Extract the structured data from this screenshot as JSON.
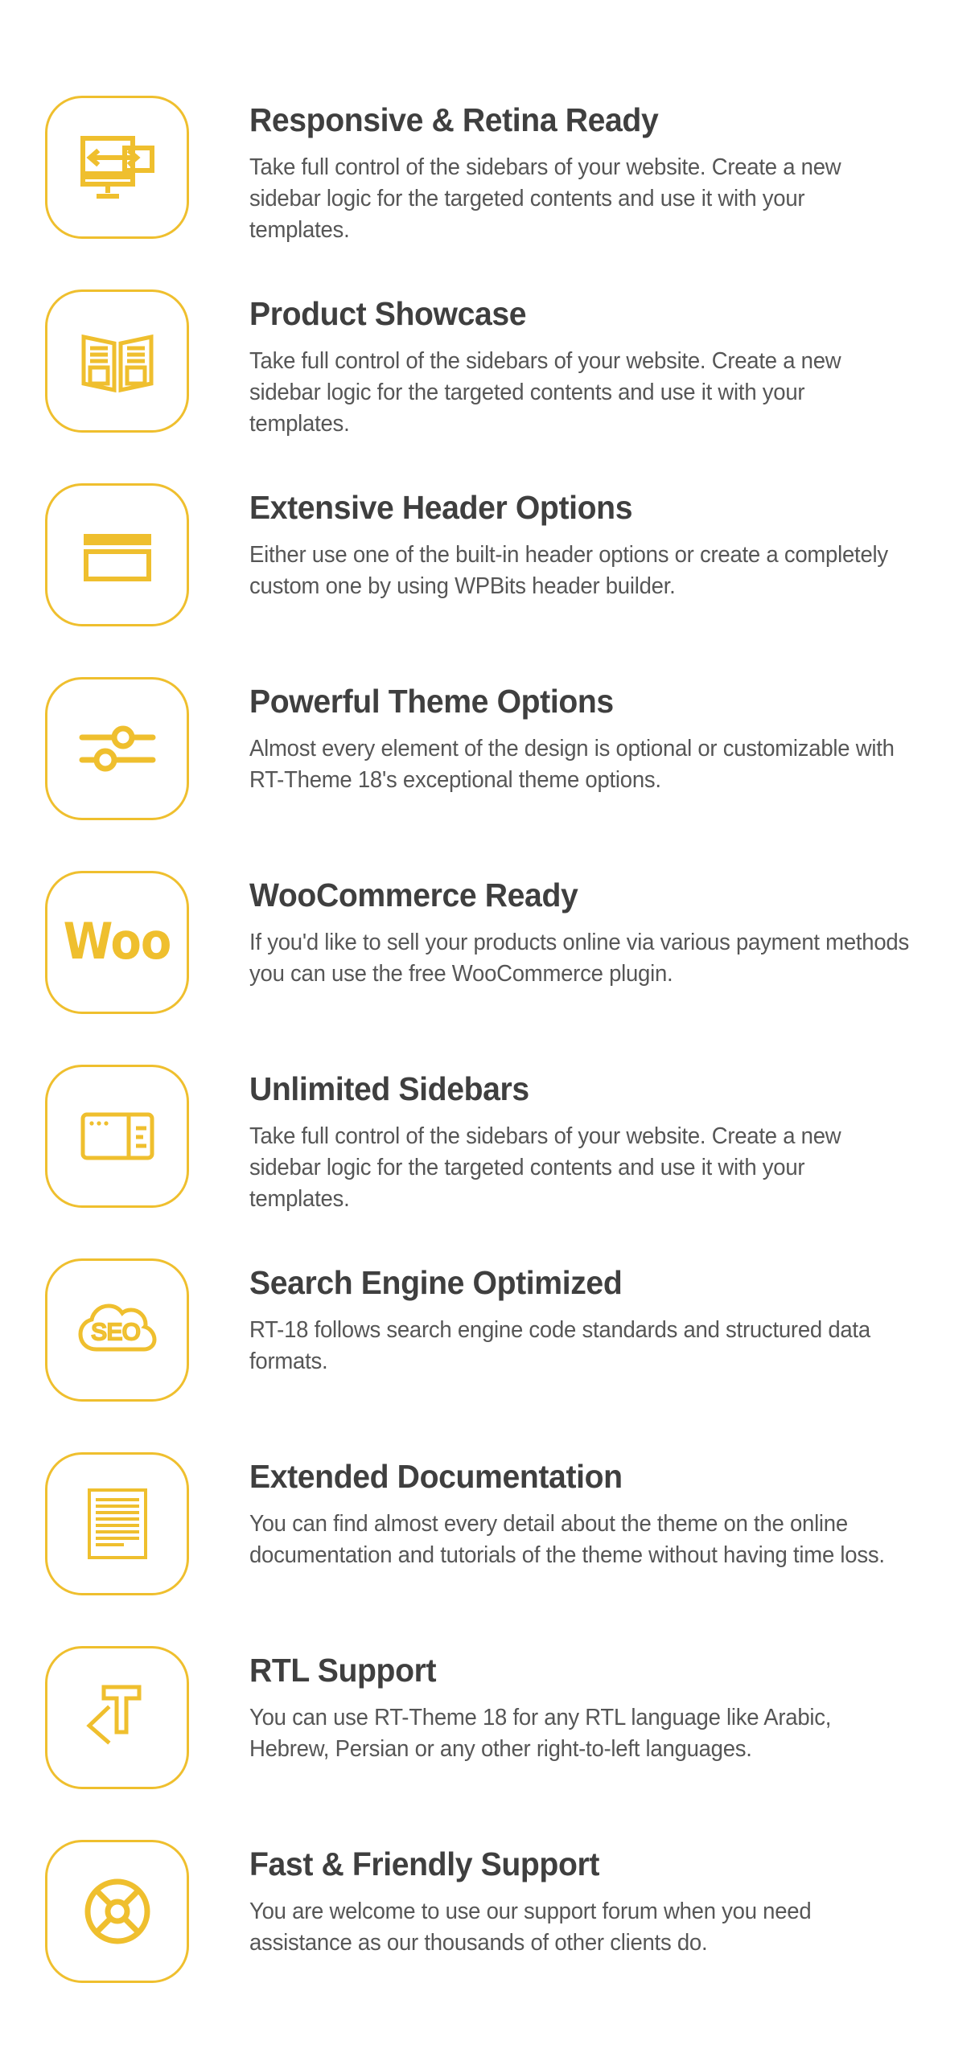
{
  "theme": {
    "accent_color": "#efbf2e",
    "title_color": "#3f3f3f",
    "body_color": "#565656",
    "background_color": "#ffffff"
  },
  "features": [
    {
      "icon": "responsive-monitor-icon",
      "title": "Responsive & Retina Ready",
      "description": "Take full control of the sidebars of your website. Create a new sidebar logic for the targeted contents and use it with your templates."
    },
    {
      "icon": "brochure-icon",
      "title": "Product Showcase",
      "description": "Take full control of the sidebars of your website. Create a new sidebar logic for the targeted contents and use it with your templates."
    },
    {
      "icon": "header-layout-icon",
      "title": "Extensive Header Options",
      "description": "Either use one of the built-in header options or create a completely custom one by using WPBits header builder."
    },
    {
      "icon": "sliders-icon",
      "title": "Powerful Theme Options",
      "description": "Almost every element of the design is optional or customizable with RT-Theme 18's exceptional theme options."
    },
    {
      "icon": "woocommerce-icon",
      "icon_text": "Woo",
      "title": "WooCommerce Ready",
      "description": "If you'd like to sell your products online via various payment methods you can use the free WooCommerce plugin."
    },
    {
      "icon": "sidebar-layout-icon",
      "title": "Unlimited Sidebars",
      "description": "Take full control of the sidebars of your website. Create a new sidebar logic for the targeted contents and use it with your templates."
    },
    {
      "icon": "seo-cloud-icon",
      "icon_text": "SEO",
      "title": "Search Engine Optimized",
      "description": "RT-18 follows search engine code standards and structured data formats."
    },
    {
      "icon": "document-lines-icon",
      "title": "Extended Documentation",
      "description": "You can find almost every detail about the theme on the online documentation and tutorials of the theme without having time loss."
    },
    {
      "icon": "rtl-text-icon",
      "title": "RTL Support",
      "description": "You can use RT-Theme 18 for any RTL language like Arabic, Hebrew, Persian or any other right-to-left languages."
    },
    {
      "icon": "lifebuoy-icon",
      "title": "Fast & Friendly Support",
      "description": "You are welcome to use our support forum when you need assistance as our thousands of other clients do."
    }
  ]
}
